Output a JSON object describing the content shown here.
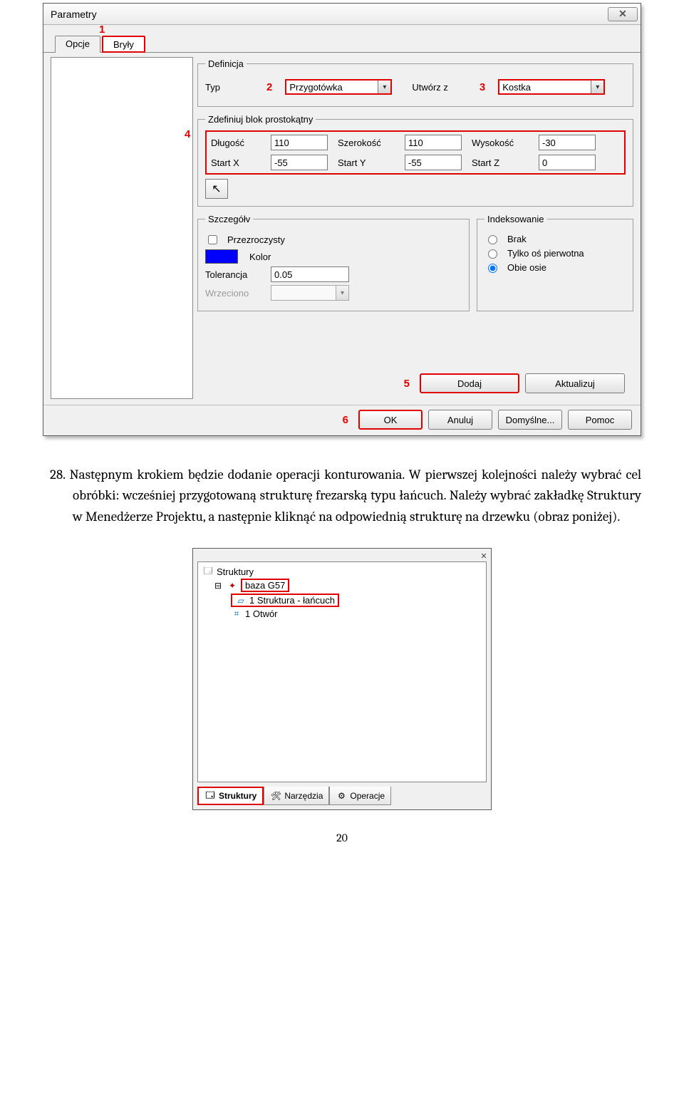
{
  "dialog": {
    "title": "Parametry",
    "tabs": {
      "opcje": "Opcje",
      "bryly": "Bryły"
    },
    "definicja": {
      "legend": "Definicja",
      "typ_label": "Typ",
      "typ_value": "Przygotówka",
      "utworz_label": "Utwórz z",
      "utworz_value": "Kostka"
    },
    "blok": {
      "legend": "Zdefiniuj blok prostokątny",
      "dlugosc_label": "Długość",
      "dlugosc": "110",
      "szer_label": "Szerokość",
      "szer": "110",
      "wys_label": "Wysokość",
      "wys": "-30",
      "sx_label": "Start X",
      "sx": "-55",
      "sy_label": "Start Y",
      "sy": "-55",
      "sz_label": "Start Z",
      "sz": "0"
    },
    "szczegoly": {
      "legend": "Szczegółv",
      "przezroczysty": "Przezroczysty",
      "kolor": "Kolor",
      "tolerancja_label": "Tolerancja",
      "tolerancja": "0.05",
      "wrzeciono": "Wrzeciono"
    },
    "indeks": {
      "legend": "Indeksowanie",
      "brak": "Brak",
      "tylko": "Tylko oś pierwotna",
      "obie": "Obie osie"
    },
    "buttons": {
      "dodaj": "Dodaj",
      "aktualizuj": "Aktualizuj",
      "ok": "OK",
      "anuluj": "Anuluj",
      "domyslne": "Domyślne...",
      "pomoc": "Pomoc"
    },
    "marks": {
      "m1": "1",
      "m2": "2",
      "m3": "3",
      "m4": "4",
      "m5": "5",
      "m6": "6"
    }
  },
  "paragraph": {
    "num": "28.",
    "text": "Następnym krokiem będzie dodanie operacji konturowania. W pierwszej kolejności należy wybrać cel obróbki: wcześniej przygotowaną strukturę frezarską typu łańcuch. Należy wybrać zakładkę Struktury w Menedżerze Projektu, a następnie kliknąć na odpowiednią strukturę na drzewku (obraz poniżej)."
  },
  "panel2": {
    "root": "Struktury",
    "baza": "baza G57",
    "item1": "1 Struktura - łańcuch",
    "item2": "1 Otwór",
    "tabs": {
      "struktury": "Struktury",
      "narzedzia": "Narzędzia",
      "operacje": "Operacje"
    }
  },
  "page_number": "20"
}
